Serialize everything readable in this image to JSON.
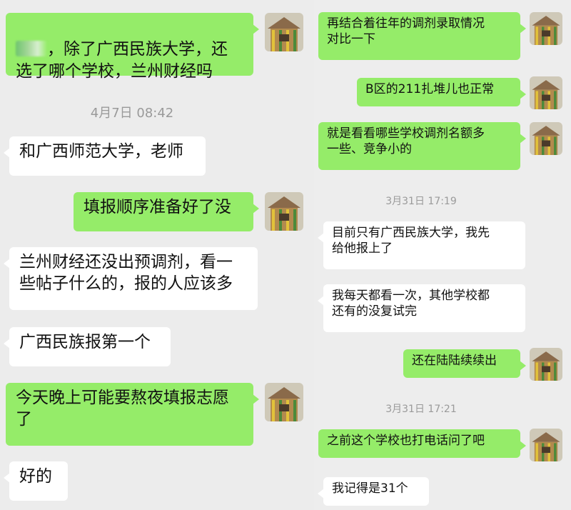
{
  "left": {
    "messages": [
      {
        "text": "，除了广西民族大学，还\n选了哪个学校，兰州财经吗"
      },
      {
        "text": "和广西师范大学，老师"
      },
      {
        "text": "填报顺序准备好了没"
      },
      {
        "text": "兰州财经还没出预调剂，看一\n些帖子什么的，报的人应该多"
      },
      {
        "text": "广西民族报第一个"
      },
      {
        "text": "今天晚上可能要熬夜填报志愿\n了"
      },
      {
        "text": "好的"
      }
    ],
    "timestamps": [
      "4月7日 08:42"
    ]
  },
  "right": {
    "messages": [
      {
        "text": "再结合着往年的调剂录取情况\n对比一下"
      },
      {
        "text": "B区的211扎堆儿也正常"
      },
      {
        "text": "就是看看哪些学校调剂名额多\n一些、竞争小的"
      },
      {
        "text": "目前只有广西民族大学，我先\n给他报上了"
      },
      {
        "text": "我每天都看一次，其他学校都\n还有的没复试完"
      },
      {
        "text": "还在陆陆续续出"
      },
      {
        "text": "之前这个学校也打电话问了吧"
      },
      {
        "text": "我记得是31个"
      }
    ],
    "timestamps": [
      "3月31日 17:19",
      "3月31日 17:21"
    ]
  },
  "avatar": {
    "icon": "wooden-hut-avatar-icon"
  },
  "colors": {
    "sent": "#95ec69",
    "received": "#ffffff",
    "timestamp": "#9a9a9a"
  }
}
